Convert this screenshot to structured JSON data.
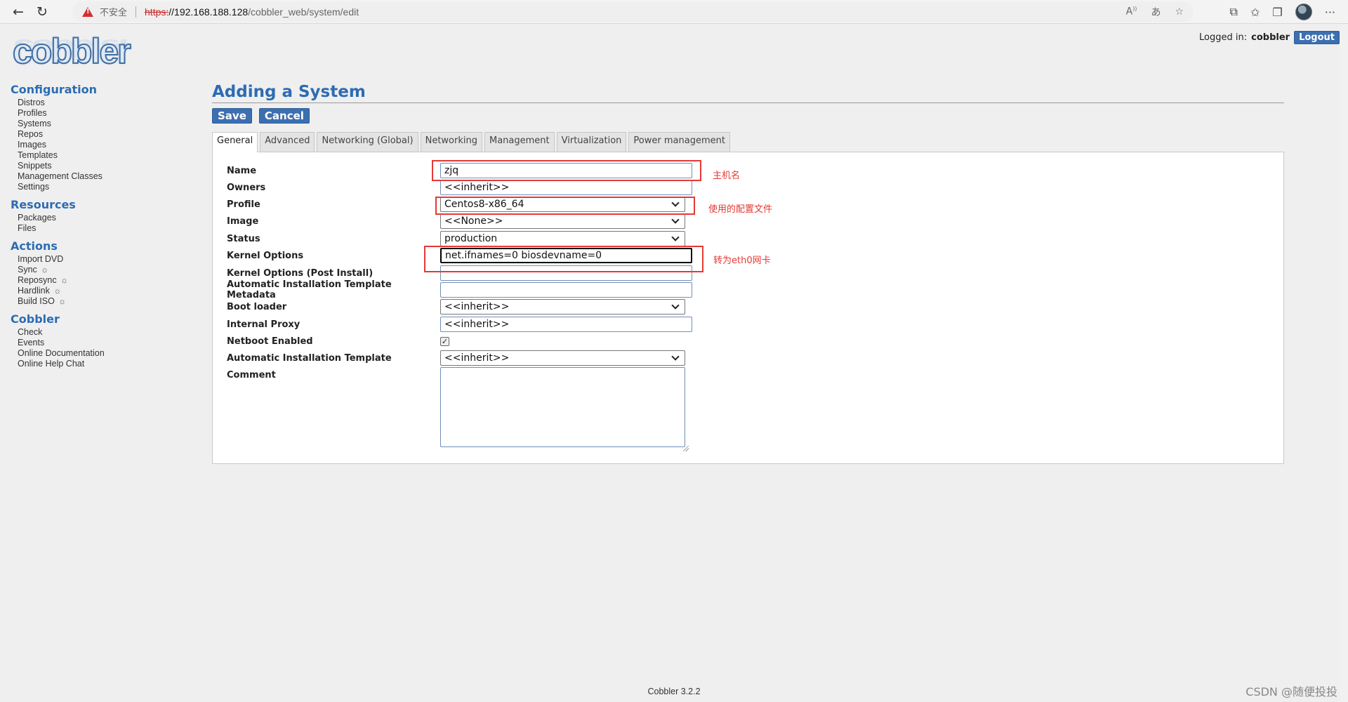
{
  "browser": {
    "insecure_label": "不安全",
    "url_scheme": "https:",
    "url_host": "//192.168.188.128",
    "url_path": "/cobbler_web/system/edit",
    "back_icon": "arrow-left-icon",
    "reload_icon": "reload-icon",
    "warning_icon": "warning-triangle-icon",
    "addr_icons": [
      "read-aloud-icon",
      "translate-icon",
      "favorite-add-icon"
    ],
    "toolbar_icons": [
      "extensions-icon",
      "favorites-icon",
      "collections-icon",
      "profile-avatar",
      "more-icon"
    ],
    "read_aloud_glyph": "A",
    "translate_glyph": "あ",
    "more_glyph": "···"
  },
  "header": {
    "logo_text": "cobbler",
    "logged_in_label": "Logged in:",
    "user": "cobbler",
    "logout_label": "Logout"
  },
  "sidebar": {
    "sections": [
      {
        "title": "Configuration",
        "items": [
          "Distros",
          "Profiles",
          "Systems",
          "Repos",
          "Images",
          "Templates",
          "Snippets",
          "Management Classes",
          "Settings"
        ]
      },
      {
        "title": "Resources",
        "items": [
          "Packages",
          "Files"
        ]
      },
      {
        "title": "Actions",
        "items": [
          "Import DVD",
          "Sync",
          "Reposync",
          "Hardlink",
          "Build ISO"
        ]
      },
      {
        "title": "Cobbler",
        "items": [
          "Check",
          "Events",
          "Online Documentation",
          "Online Help Chat"
        ]
      }
    ],
    "gear_glyph": "☼"
  },
  "main": {
    "title": "Adding a System",
    "save_label": "Save",
    "cancel_label": "Cancel",
    "tabs": [
      "General",
      "Advanced",
      "Networking (Global)",
      "Networking",
      "Management",
      "Virtualization",
      "Power management"
    ],
    "active_tab": "General"
  },
  "form": {
    "name": {
      "label": "Name",
      "value": "zjq"
    },
    "owners": {
      "label": "Owners",
      "value": "<<inherit>>"
    },
    "profile": {
      "label": "Profile",
      "value": "Centos8-x86_64"
    },
    "image": {
      "label": "Image",
      "value": "<<None>>"
    },
    "status": {
      "label": "Status",
      "value": "production"
    },
    "kernel_options": {
      "label": "Kernel Options",
      "value": "net.ifnames=0 biosdevname=0"
    },
    "kernel_options_post": {
      "label": "Kernel Options (Post Install)",
      "value": ""
    },
    "autoinstall_meta": {
      "label": "Automatic Installation Template Metadata",
      "value": ""
    },
    "boot_loader": {
      "label": "Boot loader",
      "value": "<<inherit>>"
    },
    "internal_proxy": {
      "label": "Internal Proxy",
      "value": "<<inherit>>"
    },
    "netboot_enabled": {
      "label": "Netboot Enabled",
      "checked": true,
      "check_glyph": "✓"
    },
    "autoinstall_template": {
      "label": "Automatic Installation Template",
      "value": "<<inherit>>"
    },
    "comment": {
      "label": "Comment",
      "value": ""
    }
  },
  "annotations": {
    "hostname": "主机名",
    "profile": "使用的配置文件",
    "kernel": "转为eth0网卡",
    "color": "#e53935"
  },
  "footer": {
    "version": "Cobbler 3.2.2"
  },
  "watermark": "CSDN @随便投投"
}
